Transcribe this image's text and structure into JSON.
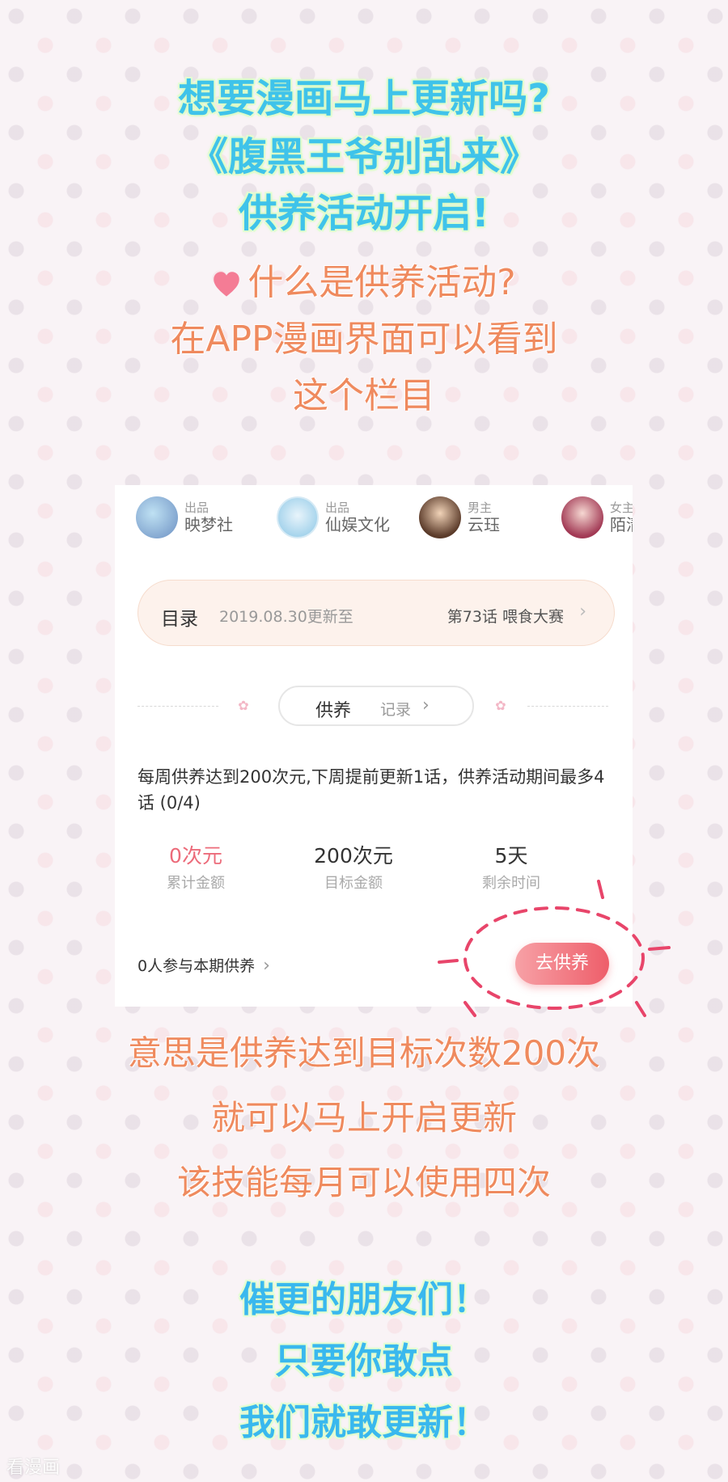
{
  "headline": {
    "line1": "想要漫画马上更新吗?",
    "line2": "《腹黑王爷别乱来》",
    "line3": "供养活动开启!"
  },
  "intro": {
    "question": "什么是供养活动?",
    "line1": "在APP漫画界面可以看到",
    "line2": "这个栏目"
  },
  "card": {
    "producers": [
      {
        "role": "出品",
        "name": "映梦社"
      },
      {
        "role": "出品",
        "name": "仙娱文化"
      },
      {
        "role": "男主",
        "name": "云珏"
      },
      {
        "role": "女主",
        "name": "陌清"
      }
    ],
    "catalog": {
      "label": "目录",
      "date": "2019.08.30更新至",
      "latest": "第73话 喂食大赛"
    },
    "support": {
      "title": "供养",
      "record": "记录"
    },
    "description": "每周供养达到200次元,下周提前更新1话，供养活动期间最多4话 (0/4)",
    "stats": [
      {
        "value": "0次元",
        "label": "累计金额"
      },
      {
        "value": "200次元",
        "label": "目标金额"
      },
      {
        "value": "5天",
        "label": "剩余时间"
      }
    ],
    "participants": "0人参与本期供养",
    "go_button": "去供养"
  },
  "explain": {
    "line1": "意思是供养达到目标次数200次",
    "line2": "就可以马上开启更新",
    "line3": "该技能每月可以使用四次"
  },
  "closing": {
    "line1": "催更的朋友们！",
    "line2": "只要你敢点",
    "line3": "我们就敢更新！"
  },
  "watermark": "看漫画",
  "colors": {
    "headline": "#3fc3ea",
    "orange_text": "#ef8a5e",
    "accent_pink": "#ec6b7a",
    "button_gradient_end": "#ee5e6a"
  }
}
